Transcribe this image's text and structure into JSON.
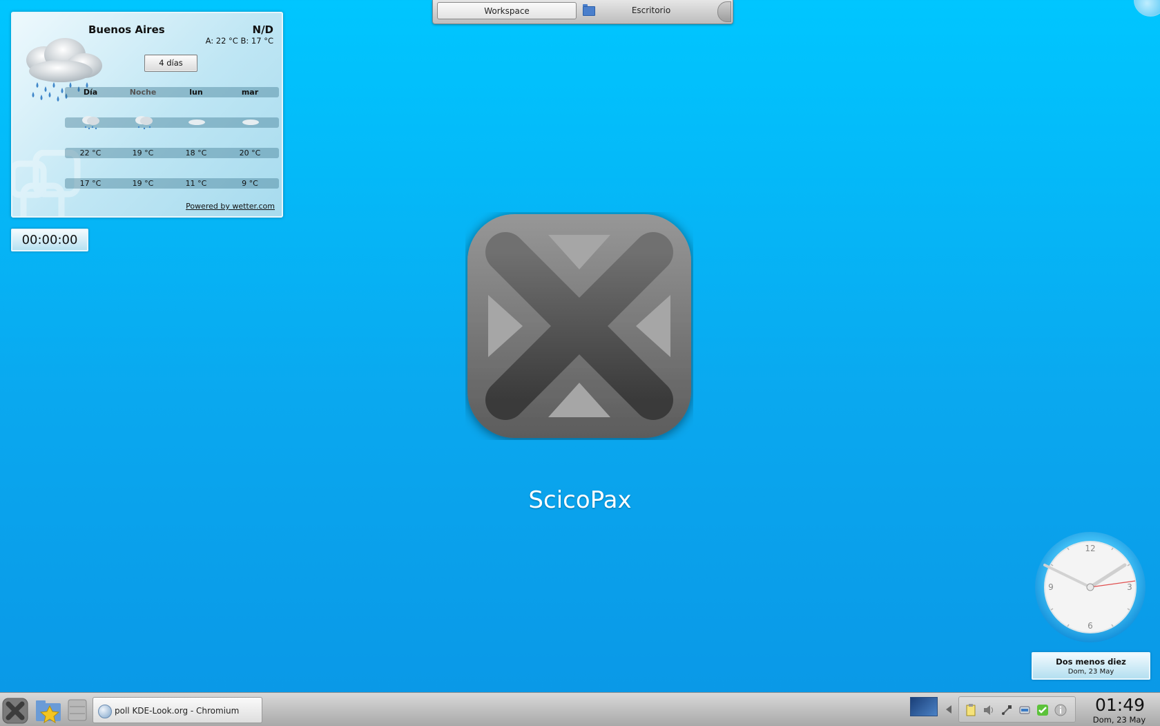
{
  "top_panel": {
    "workspace_label": "Workspace",
    "desktop_label": "Escritorio"
  },
  "weather": {
    "city": "Buenos Aires",
    "condition": "N/D",
    "high_low": "A: 22 °C B: 17 °C",
    "days_button": "4 días",
    "columns": [
      "Día",
      "Noche",
      "lun",
      "mar"
    ],
    "icons": [
      "rain-cloud-icon",
      "rain-cloud-icon",
      "cloud-icon",
      "cloud-icon"
    ],
    "highs": [
      "22 °C",
      "19 °C",
      "18 °C",
      "20 °C"
    ],
    "lows": [
      "17 °C",
      "19 °C",
      "11 °C",
      "9 °C"
    ],
    "credit": "Powered by wetter.com"
  },
  "timer": {
    "value": "00:00:00"
  },
  "brand": {
    "name": "ScicoPax"
  },
  "clock_widget": {
    "caption": "Dos menos diez",
    "date": "Dom, 23 May",
    "dial_numbers": [
      "12",
      "3",
      "6",
      "9"
    ]
  },
  "taskbar": {
    "task_title": "poll KDE-Look.org - Chromium",
    "time": "01:49",
    "date": "Dom, 23 May"
  },
  "colors": {
    "desktop_top": "#00c6ff",
    "desktop_bottom": "#0a97e6",
    "second_hand": "#e05050"
  }
}
